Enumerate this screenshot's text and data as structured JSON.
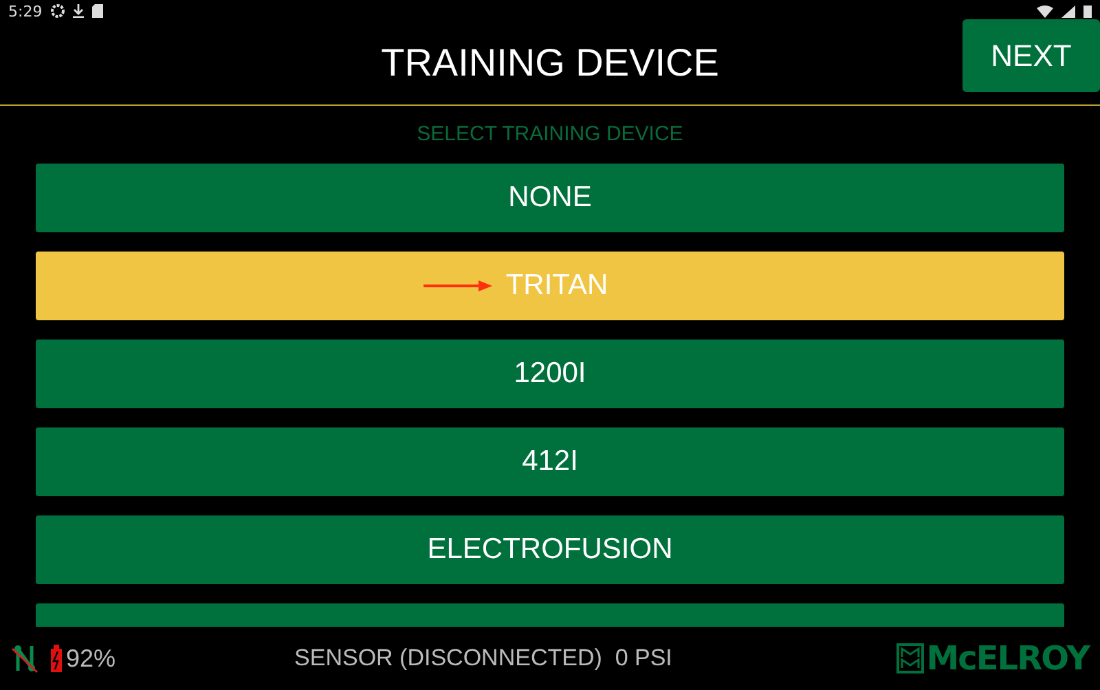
{
  "status_bar": {
    "time": "5:29"
  },
  "header": {
    "title": "TRAINING DEVICE",
    "next_button": "NEXT"
  },
  "subtitle": "SELECT TRAINING DEVICE",
  "devices": [
    {
      "label": "NONE",
      "selected": false
    },
    {
      "label": "TRITAN",
      "selected": true
    },
    {
      "label": "1200I",
      "selected": false
    },
    {
      "label": "412I",
      "selected": false
    },
    {
      "label": "ELECTROFUSION",
      "selected": false
    },
    {
      "selected": false
    }
  ],
  "footer": {
    "battery": "92%",
    "sensor": "SENSOR (DISCONNECTED)  0 PSI",
    "logo": "McELROY"
  }
}
